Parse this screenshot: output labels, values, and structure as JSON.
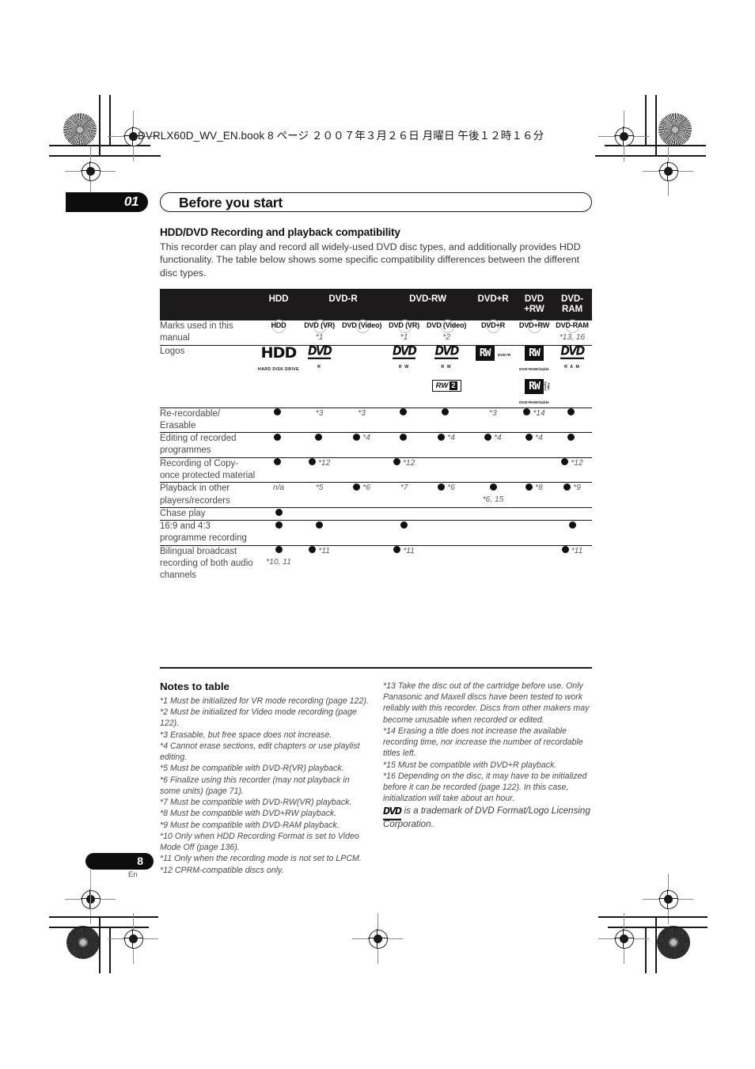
{
  "page": {
    "slug": "DVRLX60D_WV_EN.book  8 ページ  ２００７年３月２６日   月曜日   午後１２時１６分",
    "chapter_number": "01",
    "chapter_title": "Before you start",
    "page_number": "8",
    "page_language": "En"
  },
  "section": {
    "heading": "HDD/DVD Recording and playback compatibility",
    "intro": "This recorder can play and record all widely-used DVD disc types, and additionally provides HDD functionality. The table below shows some specific compatibility differences between the different disc types."
  },
  "table": {
    "headers": {
      "blank": "",
      "hdd": "HDD",
      "dvd_r": "DVD-R",
      "dvd_rw": "DVD-RW",
      "dvd_plus_r": "DVD+R",
      "dvd_plus_rw": "DVD\n+RW",
      "dvd_ram": "DVD-\nRAM"
    },
    "rows": [
      {
        "label": "Marks used in this manual",
        "cells": [
          {
            "mark": "HDD",
            "note": ""
          },
          {
            "mark": "DVD (VR)",
            "note": "*1"
          },
          {
            "mark": "DVD (Video)",
            "note": ""
          },
          {
            "mark": "DVD (VR)",
            "note": "*1"
          },
          {
            "mark": "DVD (Video)",
            "note": "*2"
          },
          {
            "mark": "DVD+R",
            "note": ""
          },
          {
            "mark": "DVD+RW",
            "note": ""
          },
          {
            "mark": "DVD-RAM",
            "note": "*13, 16"
          }
        ]
      },
      {
        "label": "Logos"
      },
      {
        "label": "Re-recordable/ Erasable",
        "cells": [
          {
            "bullet": true,
            "note": ""
          },
          {
            "bullet": false,
            "note": "*3"
          },
          {
            "bullet": false,
            "note": "*3"
          },
          {
            "bullet": true,
            "note": ""
          },
          {
            "bullet": true,
            "note": ""
          },
          {
            "bullet": false,
            "note": "*3"
          },
          {
            "bullet": true,
            "note": "*14"
          },
          {
            "bullet": true,
            "note": ""
          }
        ]
      },
      {
        "label": "Editing of recorded programmes",
        "cells": [
          {
            "bullet": true,
            "note": ""
          },
          {
            "bullet": true,
            "note": ""
          },
          {
            "bullet": true,
            "note": "*4"
          },
          {
            "bullet": true,
            "note": ""
          },
          {
            "bullet": true,
            "note": "*4"
          },
          {
            "bullet": true,
            "note": "*4"
          },
          {
            "bullet": true,
            "note": "*4"
          },
          {
            "bullet": true,
            "note": ""
          }
        ]
      },
      {
        "label": "Recording of Copy-once protected material",
        "cells": [
          {
            "bullet": true,
            "note": ""
          },
          {
            "bullet": true,
            "note": "*12"
          },
          {
            "bullet": false,
            "note": ""
          },
          {
            "bullet": true,
            "note": "*12"
          },
          {
            "bullet": false,
            "note": ""
          },
          {
            "bullet": false,
            "note": ""
          },
          {
            "bullet": false,
            "note": ""
          },
          {
            "bullet": true,
            "note": "*12"
          }
        ]
      },
      {
        "label": "Playback in other players/recorders",
        "cells": [
          {
            "bullet": false,
            "note": "n/a"
          },
          {
            "bullet": false,
            "note": "*5"
          },
          {
            "bullet": true,
            "note": "*6"
          },
          {
            "bullet": false,
            "note": "*7"
          },
          {
            "bullet": true,
            "note": "*6"
          },
          {
            "bullet": true,
            "note_below": "*6, 15"
          },
          {
            "bullet": true,
            "note": "*8"
          },
          {
            "bullet": true,
            "note": "*9"
          }
        ]
      },
      {
        "label": "Chase play",
        "cells": [
          {
            "bullet": true,
            "note": ""
          },
          {
            "bullet": false,
            "note": ""
          },
          {
            "bullet": false,
            "note": ""
          },
          {
            "bullet": false,
            "note": ""
          },
          {
            "bullet": false,
            "note": ""
          },
          {
            "bullet": false,
            "note": ""
          },
          {
            "bullet": false,
            "note": ""
          },
          {
            "bullet": false,
            "note": ""
          }
        ]
      },
      {
        "label": "16:9 and 4:3 programme recording",
        "cells": [
          {
            "bullet": true,
            "note": ""
          },
          {
            "bullet": true,
            "note": ""
          },
          {
            "bullet": false,
            "note": ""
          },
          {
            "bullet": true,
            "note": ""
          },
          {
            "bullet": false,
            "note": ""
          },
          {
            "bullet": false,
            "note": ""
          },
          {
            "bullet": false,
            "note": ""
          },
          {
            "bullet": true,
            "note": ""
          }
        ]
      },
      {
        "label": "Bilingual broadcast recording of both audio channels",
        "cells": [
          {
            "bullet": true,
            "note_below": "*10, 11"
          },
          {
            "bullet": true,
            "note": "*11"
          },
          {
            "bullet": false,
            "note": ""
          },
          {
            "bullet": true,
            "note": "*11"
          },
          {
            "bullet": false,
            "note": ""
          },
          {
            "bullet": false,
            "note": ""
          },
          {
            "bullet": false,
            "note": ""
          },
          {
            "bullet": true,
            "note": "*11"
          }
        ]
      }
    ],
    "logos": {
      "hdd_main": "HDD",
      "hdd_sub": "HARD DISK DRIVE",
      "dvd_word": "DVD",
      "dvd_r_fmt": "R",
      "dvd_rw_vr_fmt": "R W",
      "dvd_rw_video_fmt": "R W",
      "rw_word": "RW",
      "rw2_label": "RW",
      "rw2_digit": "2",
      "dvd_plus_r_cap": "DVD+R",
      "dvd_plus_rw_cap": "DVD+ReWritable",
      "dvd_plus_rw_cap2": "DVD+ReWritable",
      "dvd_ram_fmt": "R A M",
      "rw_vertical_cap": "High Speed"
    }
  },
  "notes": {
    "title": "Notes to table",
    "left": [
      "*1  Must be initialized for VR mode recording (page 122).",
      "*2  Must be initialized for Video mode recording (page 122).",
      "*3  Erasable, but free space does not increase.",
      "*4  Cannot erase sections, edit chapters or use playlist editing.",
      "*5  Must be compatible with DVD-R(VR) playback.",
      "*6  Finalize using this recorder (may not playback in some units) (page 71).",
      "*7  Must be compatible with DVD-RW(VR) playback.",
      "*8  Must be compatible with DVD+RW playback.",
      "*9  Must be compatible with DVD-RAM playback.",
      "*10  Only when HDD Recording Format is set to Video Mode Off (page 136).",
      "*11  Only when the recording mode is not set to LPCM.",
      "*12  CPRM-compatible discs only."
    ],
    "right": [
      "*13  Take the disc out of the cartridge before use. Only Panasonic and Maxell discs have been tested to work reliably with this recorder. Discs from other makers may become unusable when recorded or edited.",
      "*14  Erasing a title does not increase the available recording time, nor increase the number of recordable titles left.",
      "*15  Must be compatible with DVD+R playback.",
      "*16 Depending on the disc, it may have to be initialized before it can be recorded (page 122). In this case, initialization will take about an hour."
    ],
    "trademark_logo": "DVD",
    "trademark_text": "is a trademark of DVD Format/Logo Licensing Corporation."
  }
}
